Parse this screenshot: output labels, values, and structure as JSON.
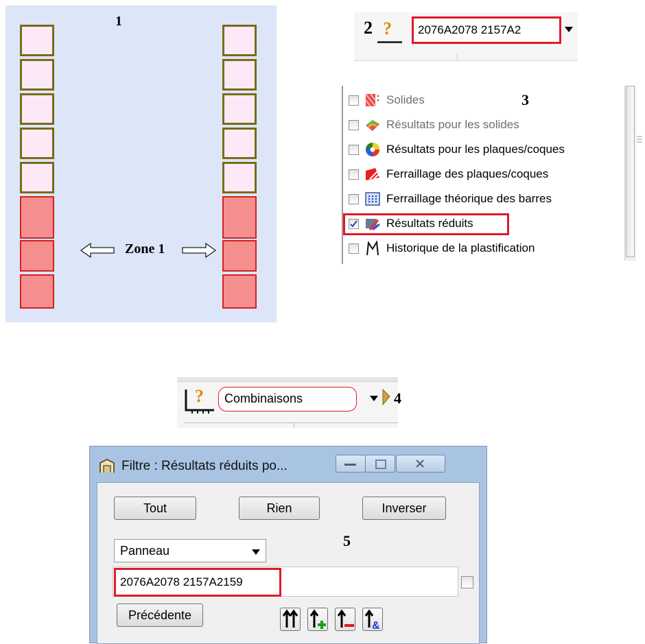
{
  "panel1": {
    "number": "1",
    "zone_label": "Zone 1"
  },
  "panel2": {
    "number": "2",
    "icon": "question-icon",
    "combo_value": "2076A2078 2157A2"
  },
  "panel3": {
    "number": "3",
    "items": [
      {
        "label": "Solides",
        "checked": false,
        "enabled": false,
        "icon": "solids-icon"
      },
      {
        "label": "Résultats pour les solides",
        "checked": false,
        "enabled": false,
        "icon": "solid-results-icon"
      },
      {
        "label": "Résultats pour les plaques/coques",
        "checked": false,
        "enabled": true,
        "icon": "plate-results-icon"
      },
      {
        "label": "Ferraillage des plaques/coques",
        "checked": false,
        "enabled": true,
        "icon": "plate-reinforcement-icon"
      },
      {
        "label": "Ferraillage théorique des barres",
        "checked": false,
        "enabled": true,
        "icon": "bar-reinforcement-icon"
      },
      {
        "label": "Résultats réduits",
        "checked": true,
        "enabled": true,
        "icon": "reduced-results-icon"
      },
      {
        "label": "Historique de la plastification",
        "checked": false,
        "enabled": true,
        "icon": "plastification-icon"
      }
    ]
  },
  "panel4": {
    "number": "4",
    "combo_value": "Combinaisons"
  },
  "panel5": {
    "number": "5",
    "title": "Filtre : Résultats réduits po...",
    "buttons": {
      "all": "Tout",
      "none": "Rien",
      "invert": "Inverser",
      "previous": "Précédente"
    },
    "select_value": "Panneau",
    "input_value": "2076A2078 2157A2159"
  },
  "colors": {
    "highlight": "#e01a2a",
    "light_cell": "#fbe9f7",
    "red_cell": "#f58e8e"
  }
}
